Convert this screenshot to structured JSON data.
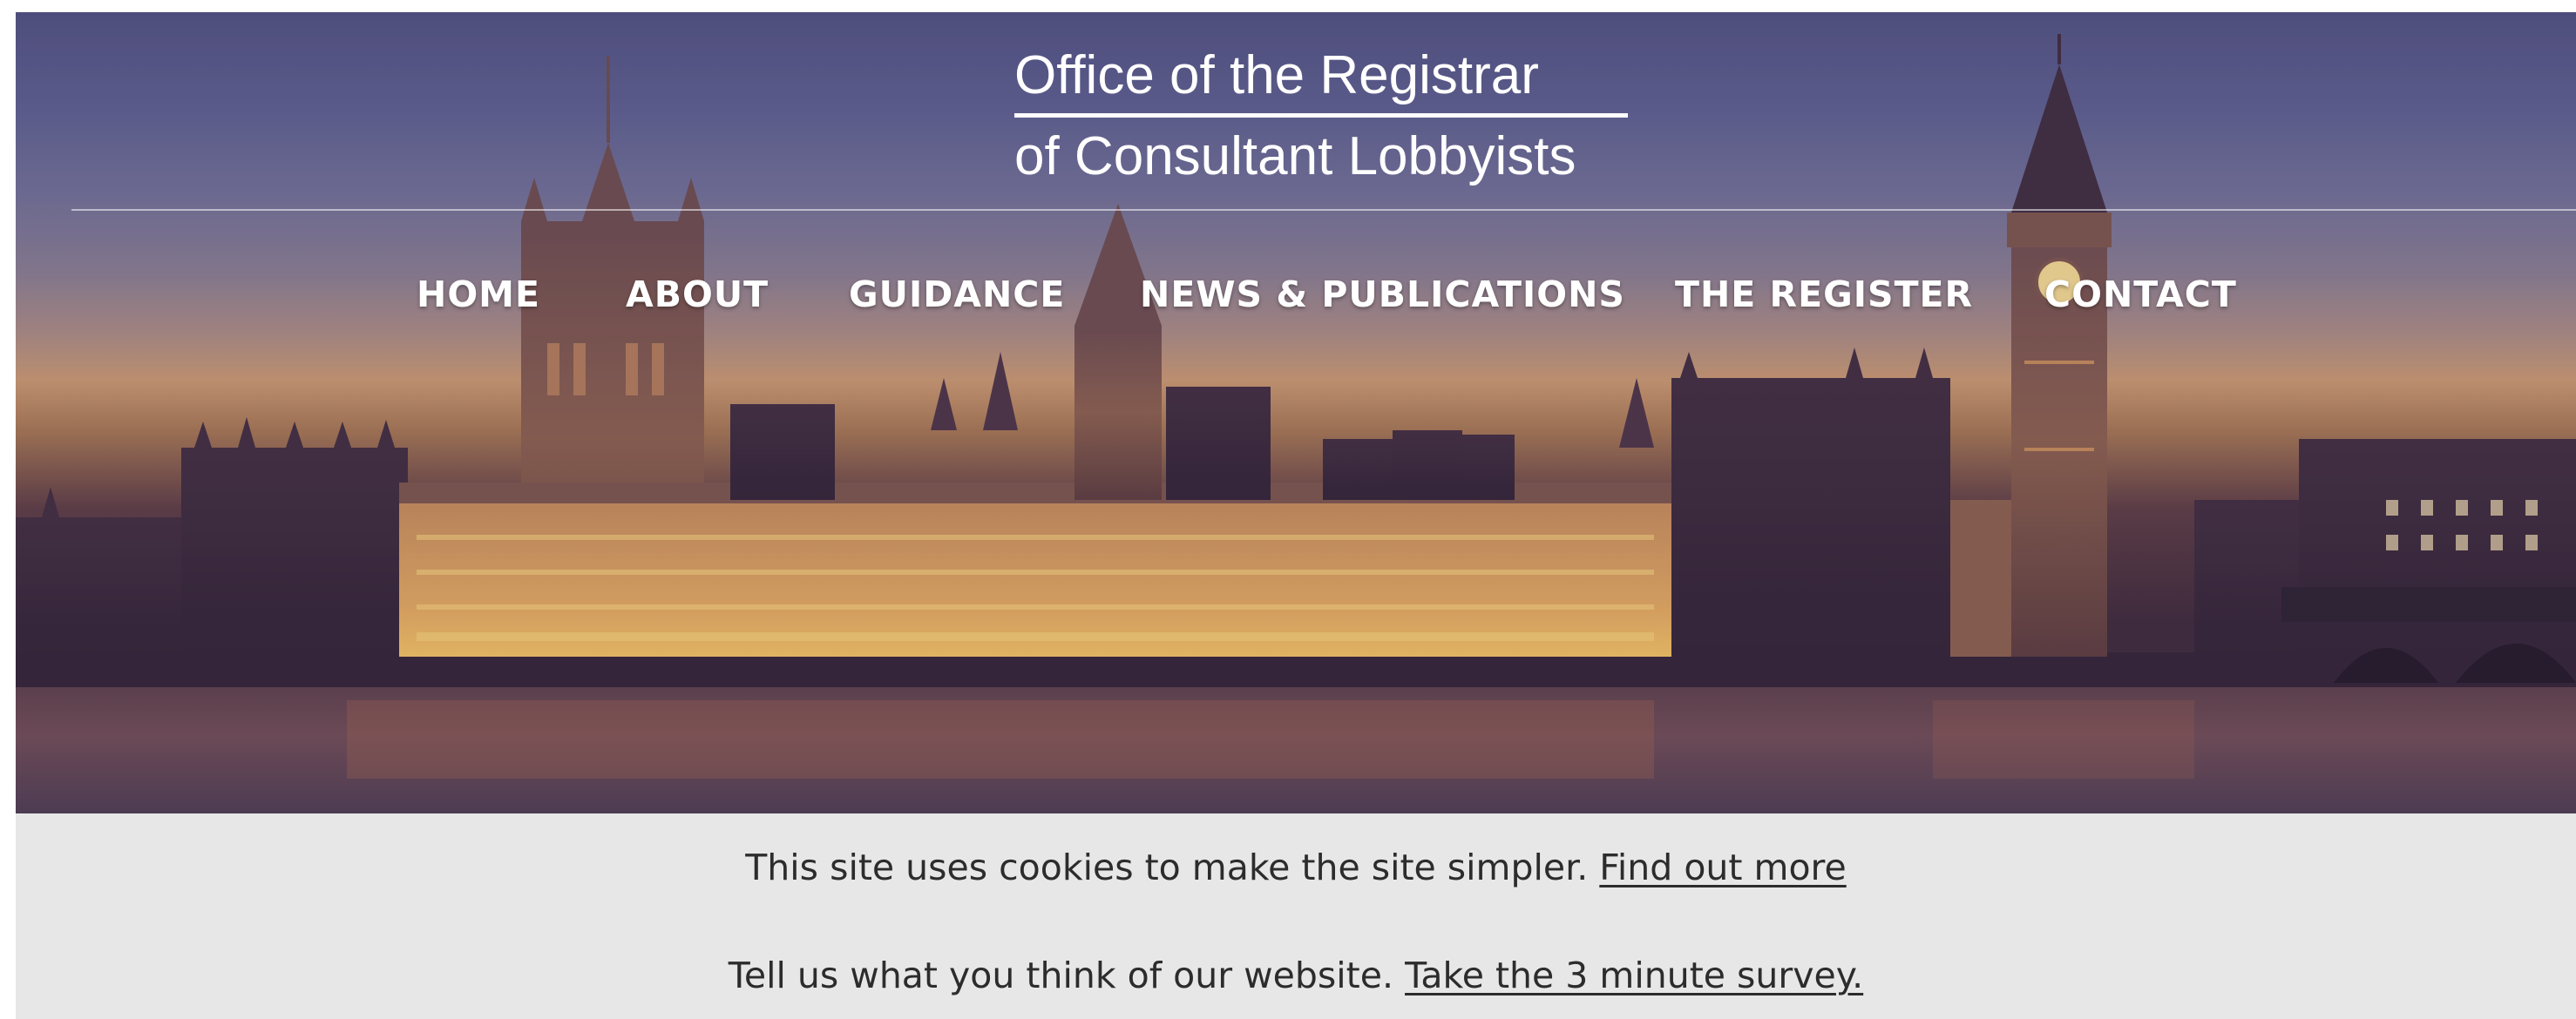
{
  "brand": {
    "line1": "Office of the Registrar",
    "line2": "of Consultant Lobbyists"
  },
  "nav": {
    "items": [
      {
        "label": "HOME"
      },
      {
        "label": "ABOUT"
      },
      {
        "label": "GUIDANCE"
      },
      {
        "label": "NEWS & PUBLICATIONS"
      },
      {
        "label": "THE REGISTER"
      },
      {
        "label": "CONTACT"
      }
    ]
  },
  "notice": {
    "cookie_text": "This site uses cookies to make the site simpler.",
    "cookie_link": "Find out more",
    "survey_text": "Tell us what you think of our website.",
    "survey_link": "Take the 3 minute survey."
  },
  "colors": {
    "sky_top": "#4d4f7c",
    "horizon_glow": "#c9986c",
    "notice_bg": "#e6e7e6",
    "text": "#2c2c2c"
  },
  "hero": {
    "image": "Houses of Parliament and Big Ben at dusk"
  }
}
